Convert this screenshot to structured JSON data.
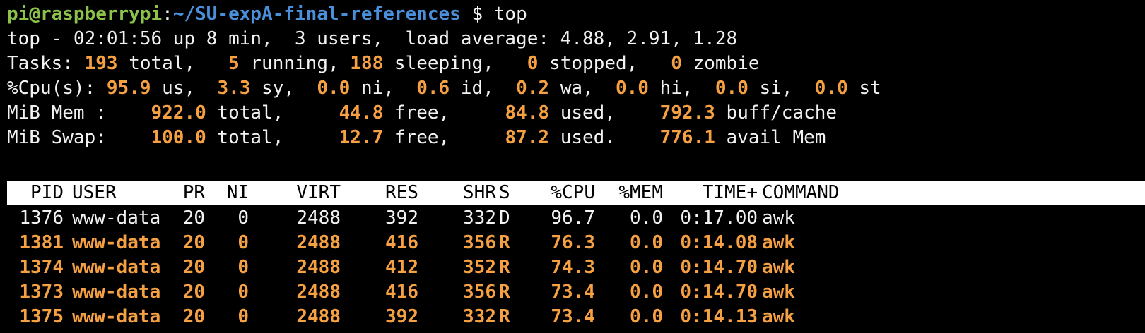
{
  "prompt": {
    "user_host": "pi@raspberrypi",
    "separator": ":",
    "path": "~/SU-expA-final-references",
    "symbol": " $ ",
    "command": "top"
  },
  "summary": {
    "uptime_line": "top - 02:01:56 up 8 min,  3 users,  load average: 4.88, 2.91, 1.28",
    "tasks": {
      "label": "Tasks: ",
      "total": "193",
      "total_label": " total,   ",
      "running": "5",
      "running_label": " running, ",
      "sleeping": "188",
      "sleeping_label": " sleeping,   ",
      "stopped": "0",
      "stopped_label": " stopped,   ",
      "zombie": "0",
      "zombie_label": " zombie"
    },
    "cpu": {
      "label": "%Cpu(s): ",
      "us": "95.9",
      "us_label": " us,  ",
      "sy": "3.3",
      "sy_label": " sy,  ",
      "ni": "0.0",
      "ni_label": " ni,  ",
      "id": "0.6",
      "id_label": " id,  ",
      "wa": "0.2",
      "wa_label": " wa,  ",
      "hi": "0.0",
      "hi_label": " hi,  ",
      "si": "0.0",
      "si_label": " si,  ",
      "st": "0.0",
      "st_label": " st"
    },
    "mem": {
      "label": "MiB Mem :    ",
      "total": "922.0",
      "total_label": " total,     ",
      "free": "44.8",
      "free_label": " free,     ",
      "used": "84.8",
      "used_label": " used,    ",
      "buff": "792.3",
      "buff_label": " buff/cache"
    },
    "swap": {
      "label": "MiB Swap:    ",
      "total": "100.0",
      "total_label": " total,     ",
      "free": "12.7",
      "free_label": " free,     ",
      "used": "87.2",
      "used_label": " used.    ",
      "avail": "776.1",
      "avail_label": " avail Mem"
    }
  },
  "table": {
    "headers": {
      "pid": "PID",
      "user": "USER",
      "pr": "PR",
      "ni": "NI",
      "virt": "VIRT",
      "res": "RES",
      "shr": "SHR",
      "s": "S",
      "cpu": "%CPU",
      "mem": "%MEM",
      "time": "TIME+",
      "command": "COMMAND"
    },
    "rows": [
      {
        "pid": "1376",
        "user": "www-data",
        "pr": "20",
        "ni": "0",
        "virt": "2488",
        "res": "392",
        "shr": "332",
        "s": "D",
        "cpu": "96.7",
        "mem": "0.0",
        "time": "0:17.00",
        "command": "awk"
      },
      {
        "pid": "1381",
        "user": "www-data",
        "pr": "20",
        "ni": "0",
        "virt": "2488",
        "res": "416",
        "shr": "356",
        "s": "R",
        "cpu": "76.3",
        "mem": "0.0",
        "time": "0:14.08",
        "command": "awk"
      },
      {
        "pid": "1374",
        "user": "www-data",
        "pr": "20",
        "ni": "0",
        "virt": "2488",
        "res": "412",
        "shr": "352",
        "s": "R",
        "cpu": "74.3",
        "mem": "0.0",
        "time": "0:14.70",
        "command": "awk"
      },
      {
        "pid": "1373",
        "user": "www-data",
        "pr": "20",
        "ni": "0",
        "virt": "2488",
        "res": "416",
        "shr": "356",
        "s": "R",
        "cpu": "73.4",
        "mem": "0.0",
        "time": "0:14.70",
        "command": "awk"
      },
      {
        "pid": "1375",
        "user": "www-data",
        "pr": "20",
        "ni": "0",
        "virt": "2488",
        "res": "392",
        "shr": "332",
        "s": "R",
        "cpu": "73.4",
        "mem": "0.0",
        "time": "0:14.13",
        "command": "awk"
      }
    ]
  },
  "colors": {
    "background": "#000000",
    "text": "#f2f2f2",
    "prompt_user": "#8bc34a",
    "prompt_path": "#4a8fd9",
    "highlight": "#f5a042",
    "header_bg": "#ffffff"
  }
}
